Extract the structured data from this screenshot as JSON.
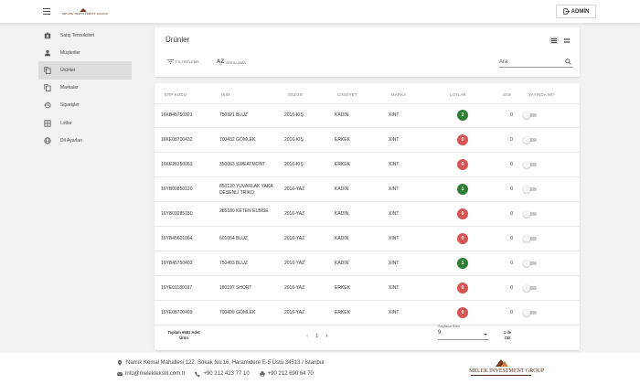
{
  "header": {
    "logo_text": "MELEK INVESTMENT GROUP",
    "admin_label": "ADMİN"
  },
  "sidebar": {
    "items": [
      {
        "label": "Satış Temsilcileri",
        "icon": "badge-icon"
      },
      {
        "label": "Müşteriler",
        "icon": "person-icon"
      },
      {
        "label": "Ürünler",
        "icon": "copy-icon",
        "active": true
      },
      {
        "label": "Markalar",
        "icon": "copy-icon"
      },
      {
        "label": "Siparişler",
        "icon": "history-icon"
      },
      {
        "label": "Lotlar",
        "icon": "grid-icon"
      },
      {
        "label": "Dil Ayarları",
        "icon": "globe-icon"
      }
    ]
  },
  "toolbar": {
    "title": "Ürünler",
    "filter_label": "FİLTRELEME",
    "sort_label": "SIRALAMA",
    "search_placeholder": "Ara"
  },
  "table": {
    "columns": [
      "ERP KODU",
      "İSİM",
      "SEZON",
      "CİNSİYET",
      "MARKA",
      "LOTLAR",
      "Stok",
      "YAYINDA MI?"
    ],
    "rows": [
      {
        "erp": "16KB45750321",
        "name": "750321 BLUZ",
        "season": "2016-KIŞ",
        "gender": "KADIN",
        "brand": "XINT",
        "lots": "2",
        "lots_status": "green",
        "stock": "0"
      },
      {
        "erp": "16KE08700432",
        "name": "700432 GÖMLEK",
        "season": "2016-KIŞ",
        "gender": "ERKEK",
        "brand": "XINT",
        "lots": "0",
        "lots_status": "red",
        "stock": "0"
      },
      {
        "erp": "16KE28350063",
        "name": "350063 SWEATMONT",
        "season": "2016-KIŞ",
        "gender": "ERKEK",
        "brand": "XINT",
        "lots": "0",
        "lots_status": "red",
        "stock": "0"
      },
      {
        "erp": "16YB00850120",
        "name": "850120 YUVARLAK YAKA DESENLİ TRİKO",
        "season": "2016-YAZ",
        "gender": "KADIN",
        "brand": "XINT",
        "lots": "1",
        "lots_status": "green",
        "stock": "0"
      },
      {
        "erp": "16YB09285180",
        "name": "285180 KETEN ELBİSE",
        "season": "2016-YAZ",
        "gender": "KADIN",
        "brand": "XINT",
        "lots": "0",
        "lots_status": "red",
        "stock": "0"
      },
      {
        "erp": "16YB45601064",
        "name": "601064 BLUZ",
        "season": "2016-YAZ",
        "gender": "KADIN",
        "brand": "XINT",
        "lots": "0",
        "lots_status": "red",
        "stock": "0"
      },
      {
        "erp": "16YB45750403",
        "name": "750403 BLUZ",
        "season": "2016-YAZ",
        "gender": "KADIN",
        "brand": "XINT",
        "lots": "1",
        "lots_status": "green",
        "stock": "0"
      },
      {
        "erp": "16YE01180197",
        "name": "180197 SHORT",
        "season": "2016-YAZ",
        "gender": "ERKEK",
        "brand": "XINT",
        "lots": "0",
        "lots_status": "red",
        "stock": "0"
      },
      {
        "erp": "16YE08700499",
        "name": "700499 GÖMLEK",
        "season": "2016-YAZ",
        "gender": "ERKEK",
        "brand": "XINT",
        "lots": "0",
        "lots_status": "red",
        "stock": "0"
      }
    ]
  },
  "pagination": {
    "total_label": "Toplam 6581 Adet Ürün",
    "current_page": "1",
    "rows_per_page_label": "Sayfada Satır",
    "rows_per_page": "9",
    "range_label": "1 ile 732"
  },
  "footer": {
    "address": "Namık Kemal Mahallesi 122. Sokak No:16, Haramidere E-5 Üstü 34513 / İstanbul",
    "email": "info@melektekstil.com.tr",
    "phone": "+90 212 423 77 10",
    "fax": "+90 212 690 64 70",
    "logo_text": "MELEK INVESTMENT GROUP"
  },
  "colors": {
    "badge_green": "#2f7d32",
    "badge_red": "#d65454",
    "logo_brown": "#7a3a1e"
  }
}
